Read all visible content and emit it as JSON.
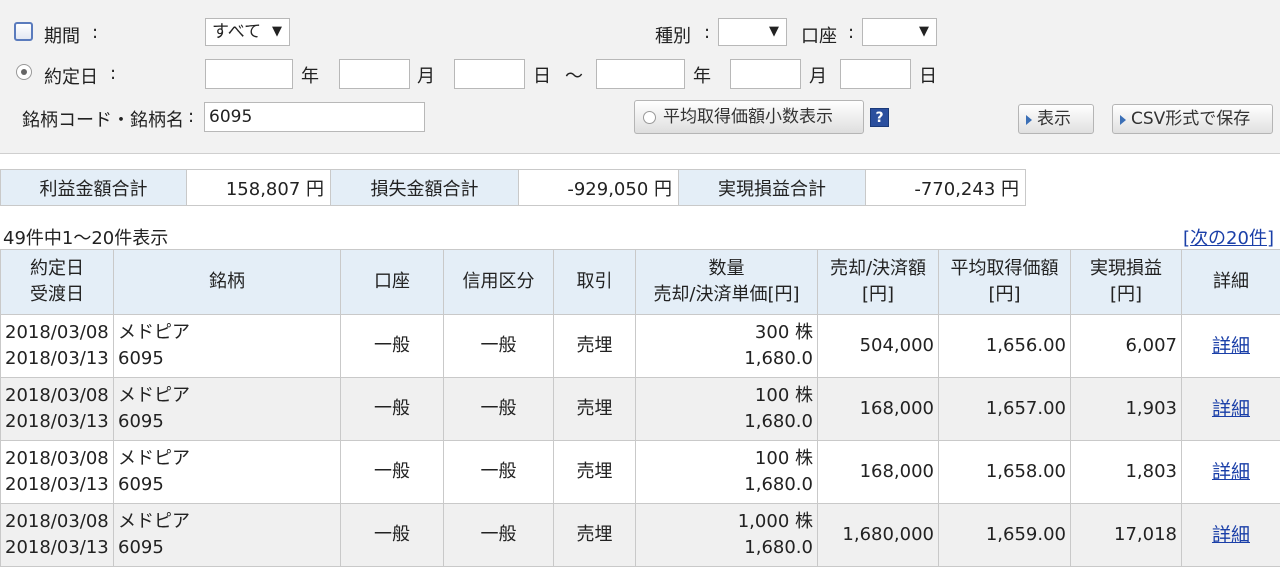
{
  "filters": {
    "period_label": "期間",
    "period_select": "すべて",
    "trade_date_label": "約定日",
    "year_label": "年",
    "month_label": "月",
    "day_label": "日",
    "range_sep": "〜",
    "code_label": "銘柄コード・銘柄名",
    "code_value": "6095",
    "type_label": "種別",
    "account_label": "口座",
    "colon": ":",
    "avg_decimal_button": "平均取得価額小数表示",
    "help_icon_text": "?",
    "show_button": "表示",
    "csv_button": "CSV形式で保存"
  },
  "summary": {
    "profit_label": "利益金額合計",
    "profit_value": "158,807 円",
    "loss_label": "損失金額合計",
    "loss_value": "-929,050 円",
    "realized_label": "実現損益合計",
    "realized_value": "-770,243 円"
  },
  "pagination": {
    "count_text": "49件中1〜20件表示",
    "bracket_open": "[",
    "next_link": "次の20件",
    "bracket_close": "]"
  },
  "table": {
    "headers": {
      "date_line1": "約定日",
      "date_line2": "受渡日",
      "stock": "銘柄",
      "account": "口座",
      "credit": "信用区分",
      "trade": "取引",
      "qty_line1": "数量",
      "qty_line2": "売却/決済単価[円]",
      "amount_line1": "売却/決済額",
      "amount_line2": "[円]",
      "avg_line1": "平均取得価額",
      "avg_line2": "[円]",
      "pl_line1": "実現損益",
      "pl_line2": "[円]",
      "detail": "詳細"
    },
    "rows": [
      {
        "trade_date": "2018/03/08",
        "settle_date": "2018/03/13",
        "name": "メドピア",
        "code": "6095",
        "account": "一般",
        "credit": "一般",
        "trade": "売埋",
        "qty": "300 株",
        "price": "1,680.0",
        "amount": "504,000",
        "avg": "1,656.00",
        "pl": "6,007",
        "detail": "詳細"
      },
      {
        "trade_date": "2018/03/08",
        "settle_date": "2018/03/13",
        "name": "メドピア",
        "code": "6095",
        "account": "一般",
        "credit": "一般",
        "trade": "売埋",
        "qty": "100 株",
        "price": "1,680.0",
        "amount": "168,000",
        "avg": "1,657.00",
        "pl": "1,903",
        "detail": "詳細"
      },
      {
        "trade_date": "2018/03/08",
        "settle_date": "2018/03/13",
        "name": "メドピア",
        "code": "6095",
        "account": "一般",
        "credit": "一般",
        "trade": "売埋",
        "qty": "100 株",
        "price": "1,680.0",
        "amount": "168,000",
        "avg": "1,658.00",
        "pl": "1,803",
        "detail": "詳細"
      },
      {
        "trade_date": "2018/03/08",
        "settle_date": "2018/03/13",
        "name": "メドピア",
        "code": "6095",
        "account": "一般",
        "credit": "一般",
        "trade": "売埋",
        "qty": "1,000 株",
        "price": "1,680.0",
        "amount": "1,680,000",
        "avg": "1,659.00",
        "pl": "17,018",
        "detail": "詳細"
      }
    ]
  },
  "colors": {
    "header_bg": "#e4eef7",
    "link": "#1a3fa8",
    "panel_bg": "#f2f2f2"
  }
}
